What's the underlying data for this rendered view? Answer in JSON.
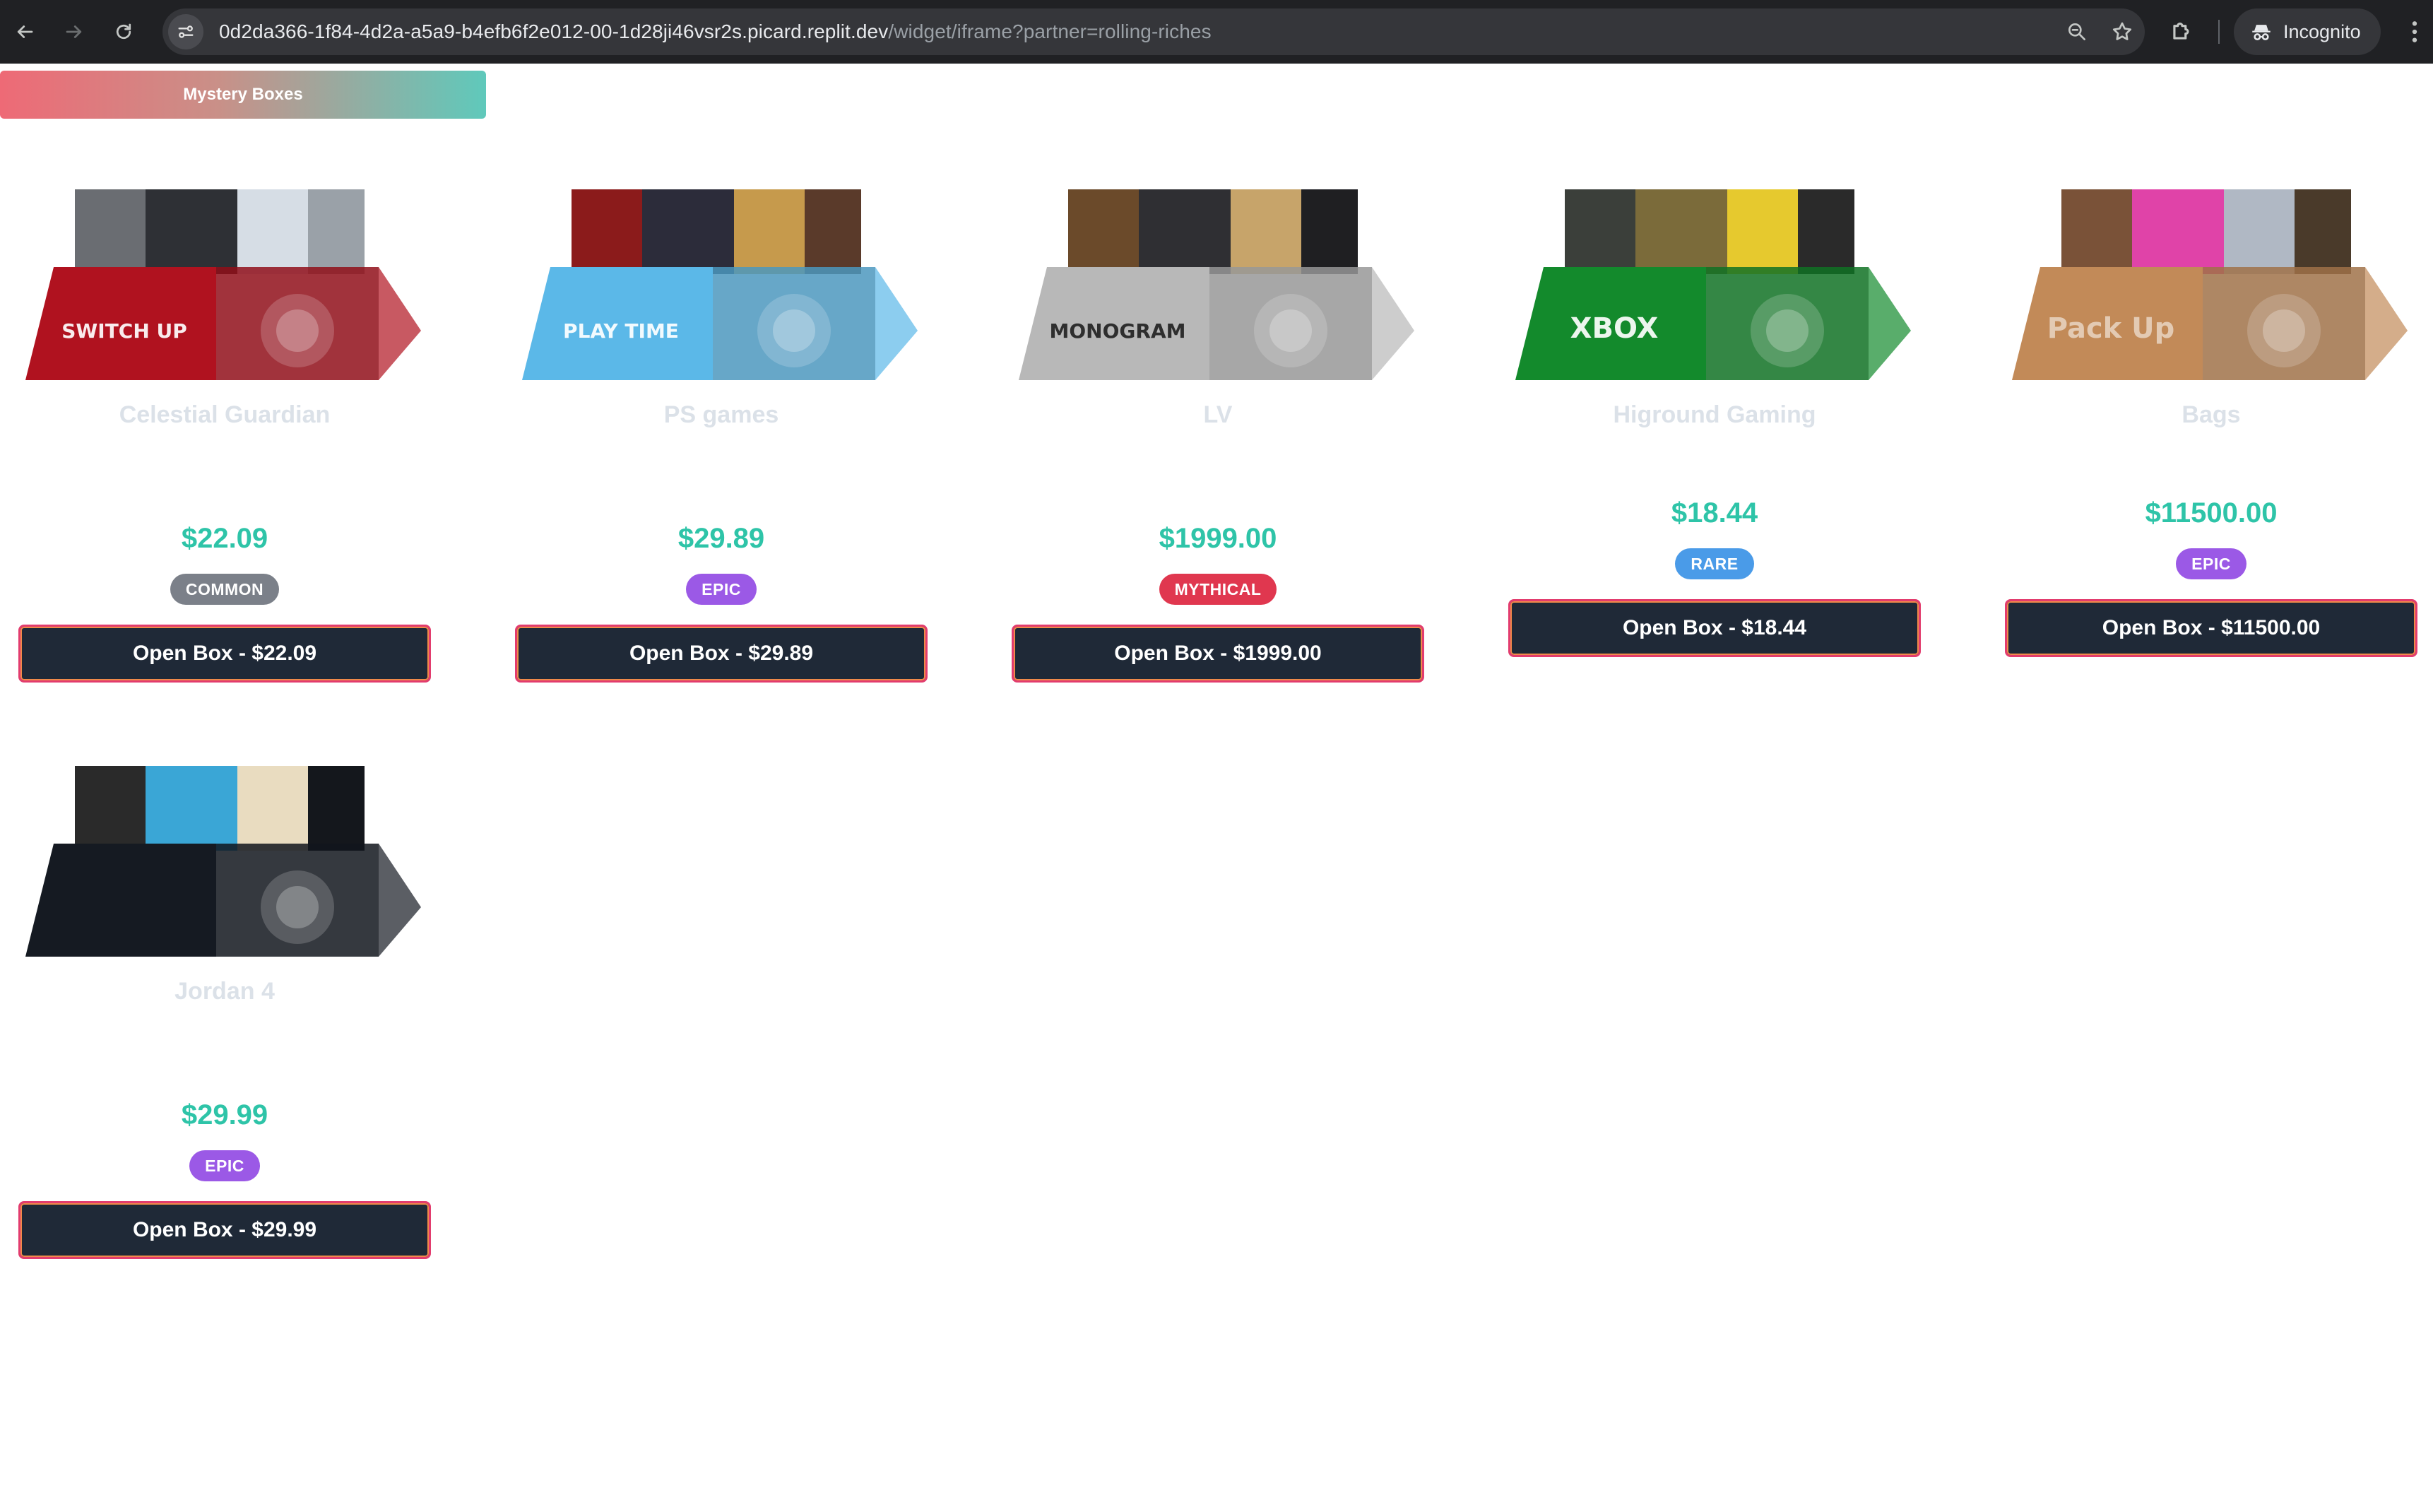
{
  "browser": {
    "url_host": "0d2da366-1f84-4d2a-a5a9-b4efb6f2e012-00-1d28ji46vsr2s.picard.replit.dev",
    "url_path": "/widget/iframe?partner=rolling-riches",
    "incognito_label": "Incognito"
  },
  "header": {
    "tab_label": "Mystery Boxes"
  },
  "boxes": [
    {
      "name": "Celestial Guardian",
      "price": "$22.09",
      "rarity": "COMMON",
      "rarity_color": "#7b8089",
      "button_label": "Open Box - $22.09",
      "theme": "switch",
      "box_color": "#b0121f",
      "panel_text": "SWITCH UP"
    },
    {
      "name": "PS games",
      "price": "$29.89",
      "rarity": "EPIC",
      "rarity_color": "#9b59e6",
      "button_label": "Open Box - $29.89",
      "theme": "ps",
      "box_color": "#5bb8e8",
      "panel_text": "PLAY TIME"
    },
    {
      "name": "LV",
      "price": "$1999.00",
      "rarity": "MYTHICAL",
      "rarity_color": "#e0374f",
      "button_label": "Open Box - $1999.00",
      "theme": "lv",
      "box_color": "#b8b8b8",
      "panel_text": "MONOGRAM"
    },
    {
      "name": "Higround Gaming",
      "price": "$18.44",
      "rarity": "RARE",
      "rarity_color": "#4a9be8",
      "button_label": "Open Box - $18.44",
      "theme": "xbox",
      "box_color": "#138a2c",
      "panel_text": "XBOX"
    },
    {
      "name": "Bags",
      "price": "$11500.00",
      "rarity": "EPIC",
      "rarity_color": "#9b59e6",
      "button_label": "Open Box - $11500.00",
      "theme": "bags",
      "box_color": "#c28a58",
      "panel_text": "Pack Up"
    },
    {
      "name": "Jordan 4",
      "price": "$29.99",
      "rarity": "EPIC",
      "rarity_color": "#9b59e6",
      "button_label": "Open Box - $29.99",
      "theme": "jordan",
      "box_color": "#151a22",
      "panel_text": ""
    }
  ]
}
